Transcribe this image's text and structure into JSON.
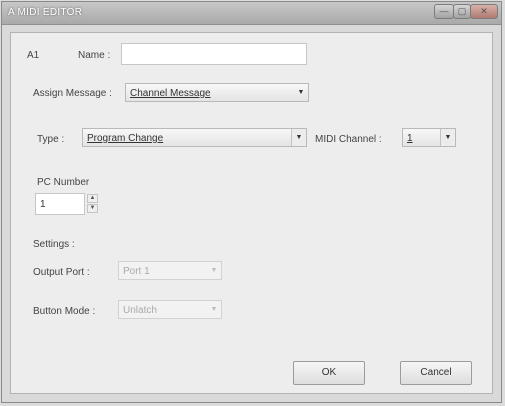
{
  "window": {
    "title": "A MIDI EDITOR",
    "minimize_glyph": "—",
    "maximize_glyph": "▢",
    "close_glyph": "✕"
  },
  "form": {
    "index_label": "A1",
    "name_label": "Name :",
    "name_value": "",
    "assign_message_label": "Assign Message :",
    "assign_message_value": "Channel Message",
    "type_label": "Type :",
    "type_value": "Program Change",
    "midi_channel_label": "MIDI Channel :",
    "midi_channel_value": "1",
    "pc_number_label": "PC Number",
    "pc_number_value": "1",
    "settings_label": "Settings :",
    "output_port_label": "Output Port :",
    "output_port_value": "Port 1",
    "button_mode_label": "Button Mode :",
    "button_mode_value": "Unlatch"
  },
  "buttons": {
    "ok_label": "OK",
    "cancel_label": "Cancel"
  },
  "icons": {
    "dropdown_arrow": "▼",
    "spin_up": "▲",
    "spin_down": "▼"
  }
}
